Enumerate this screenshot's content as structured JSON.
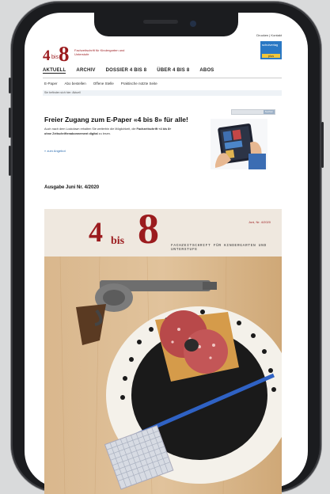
{
  "site": {
    "top_links": "Drucken | Kontakt",
    "logo": {
      "four": "4",
      "bis": "bis",
      "eight": "8",
      "tagline": "Fachzeitschrift für Kindergarten und Unterstufe"
    },
    "badge": {
      "top": "schulverlag",
      "bottom": "plus"
    },
    "main_nav": [
      "AKTUELL",
      "ARCHIV",
      "DOSSIER 4 BIS 8",
      "ÜBER 4 BIS 8",
      "ABOS"
    ],
    "sub_nav": [
      "E-Paper",
      "Abo bestellen",
      "Offene Stelle",
      "Praktische nützte Seite"
    ],
    "breadcrumb": "Sie befinden sich hier: Aktuell",
    "search": {
      "button": "Suchen"
    }
  },
  "article": {
    "headline": "Freier Zugang zum E-Paper «4 bis 8» für alle!",
    "body_plain": "Auch nach dem Lockdown erhalten Sie weiterhin die Möglichkeit, die ",
    "body_bold": "Fachzeitschrift «4 bis 8» ohne Zeitschriftenabonnement digital",
    "body_end": " zu lesen.",
    "link": "» zum Angebot",
    "issue_label": "Ausgabe Juni Nr. 4/2020"
  },
  "cover": {
    "four": "4",
    "bis": "bis",
    "eight": "8",
    "issue": "Juni, Nr. 4/2020",
    "subtitle": "FACHZEITSCHRIFT FÜR KINDERGARTEN UND UNTERSTUFE"
  },
  "colors": {
    "brand_red": "#9b1b1e",
    "link_blue": "#2b6cb0",
    "phone_frame": "#1b1c1f"
  }
}
